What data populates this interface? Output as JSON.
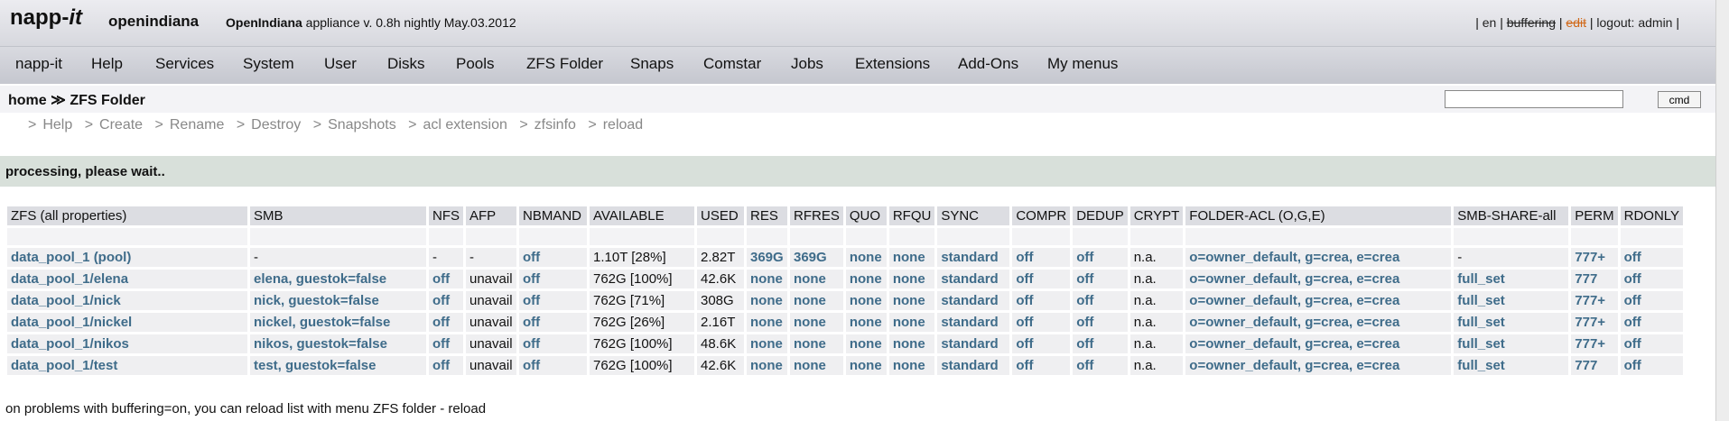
{
  "header": {
    "brand_main": "napp-",
    "brand_italic": "it",
    "host": "openindiana",
    "appliance_bold": "OpenIndiana",
    "appliance_rest": " appliance v. 0.8h nightly May.03.2012",
    "top_links": {
      "sep": "|",
      "lang": "en",
      "buffering": "buffering",
      "edit": "edit",
      "logout": "logout: admin"
    }
  },
  "menu": [
    "napp-it",
    "Help",
    "Services",
    "System",
    "User",
    "Disks",
    "Pools",
    "ZFS Folder",
    "Snaps",
    "Comstar",
    "Jobs",
    "Extensions",
    "Add-Ons",
    "My menus"
  ],
  "breadcrumb": {
    "home": "home",
    "sep": "≫",
    "current": "ZFS Folder"
  },
  "cmd": {
    "value": "",
    "button": "cmd"
  },
  "subnav": {
    "sep": ">",
    "items": [
      "Help",
      "Create",
      "Rename",
      "Destroy",
      "Snapshots",
      "acl extension",
      "zfsinfo",
      "reload"
    ]
  },
  "processing": "processing, please wait..",
  "table": {
    "headers": [
      "ZFS (all properties)",
      "SMB",
      "NFS",
      "AFP",
      "NBMAND",
      "AVAILABLE",
      "USED",
      "RES",
      "RFRES",
      "QUO",
      "RFQU",
      "SYNC",
      "COMPR",
      "DEDUP",
      "CRYPT",
      "FOLDER-ACL (O,G,E)",
      "SMB-SHARE-all",
      "PERM",
      "RDONLY"
    ],
    "rows": [
      [
        "data_pool_1 (pool)",
        "-",
        "-",
        "-",
        "off",
        "1.10T [28%]",
        "2.82T",
        "369G",
        "369G",
        "none",
        "none",
        "standard",
        "off",
        "off",
        "n.a.",
        "o=owner_default, g=crea, e=crea",
        "-",
        "777+",
        "off"
      ],
      [
        "data_pool_1/elena",
        "elena, guestok=false",
        "off",
        "unavail",
        "off",
        "762G [100%]",
        "42.6K",
        "none",
        "none",
        "none",
        "none",
        "standard",
        "off",
        "off",
        "n.a.",
        "o=owner_default, g=crea, e=crea",
        "full_set",
        "777",
        "off"
      ],
      [
        "data_pool_1/nick",
        "nick, guestok=false",
        "off",
        "unavail",
        "off",
        "762G [71%]",
        "308G",
        "none",
        "none",
        "none",
        "none",
        "standard",
        "off",
        "off",
        "n.a.",
        "o=owner_default, g=crea, e=crea",
        "full_set",
        "777+",
        "off"
      ],
      [
        "data_pool_1/nickel",
        "nickel, guestok=false",
        "off",
        "unavail",
        "off",
        "762G [26%]",
        "2.16T",
        "none",
        "none",
        "none",
        "none",
        "standard",
        "off",
        "off",
        "n.a.",
        "o=owner_default, g=crea, e=crea",
        "full_set",
        "777+",
        "off"
      ],
      [
        "data_pool_1/nikos",
        "nikos, guestok=false",
        "off",
        "unavail",
        "off",
        "762G [100%]",
        "48.6K",
        "none",
        "none",
        "none",
        "none",
        "standard",
        "off",
        "off",
        "n.a.",
        "o=owner_default, g=crea, e=crea",
        "full_set",
        "777+",
        "off"
      ],
      [
        "data_pool_1/test",
        "test, guestok=false",
        "off",
        "unavail",
        "off",
        "762G [100%]",
        "42.6K",
        "none",
        "none",
        "none",
        "none",
        "standard",
        "off",
        "off",
        "n.a.",
        "o=owner_default, g=crea, e=crea",
        "full_set",
        "777",
        "off"
      ]
    ]
  },
  "footer_note": "on problems with buffering=on, you can reload list with menu ZFS folder - reload",
  "colors": {
    "link_bold": "#3f6c8a",
    "header_bg": "#dcdde2",
    "row_bg": "#efeff1",
    "processing_bg": "#d8e0da",
    "edit_strike": "#d06818"
  }
}
